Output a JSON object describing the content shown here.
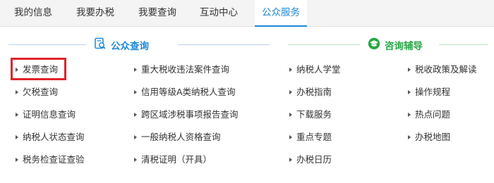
{
  "tabs": [
    {
      "label": "我的信息",
      "active": false
    },
    {
      "label": "我要办税",
      "active": false
    },
    {
      "label": "我要查询",
      "active": false
    },
    {
      "label": "互动中心",
      "active": false
    },
    {
      "label": "公众服务",
      "active": true
    }
  ],
  "sections": {
    "public_query": {
      "title": "公众查询",
      "icon": "search-document-icon",
      "color": "#1e88d8"
    },
    "consulting": {
      "title": "咨询辅导",
      "icon": "graduation-cap-icon",
      "color": "#28a745"
    }
  },
  "columns": [
    [
      "发票查询",
      "欠税查询",
      "证明信息查询",
      "纳税人状态查询",
      "税务检查证查验"
    ],
    [
      "重大税收违法案件查询",
      "信用等级A类纳税人查询",
      "跨区域涉税事项报告查询",
      "一般纳税人资格查询",
      "清税证明（开具）"
    ],
    [
      "纳税人学堂",
      "办税指南",
      "下载服务",
      "重点专题",
      "办税日历"
    ],
    [
      "税收政策及解读",
      "操作规程",
      "热点问题",
      "办税地图"
    ]
  ],
  "highlighted_item": "发票查询"
}
